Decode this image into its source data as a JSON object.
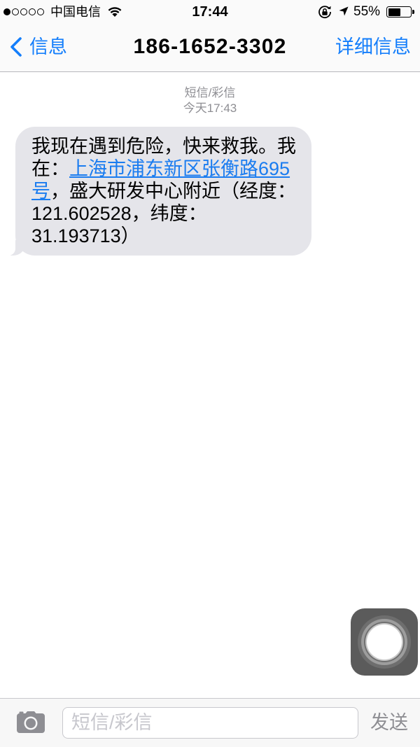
{
  "status": {
    "signal_strength": 1,
    "signal_max": 5,
    "carrier": "中国电信",
    "time": "17:44",
    "battery_text": "55%",
    "battery_level": 55
  },
  "nav": {
    "back_label": "信息",
    "title": "186-1652-3302",
    "details_label": "详细信息"
  },
  "thread": {
    "service_label": "短信/彩信",
    "timestamp": "今天17:43",
    "messages": [
      {
        "text_before": "我现在遇到危险，快来救我。我在：",
        "link_text": "上海市浦东新区张衡路695号",
        "text_after": "，盛大研发中心附近（经度：121.602528，纬度：31.193713）"
      }
    ]
  },
  "composer": {
    "placeholder": "短信/彩信",
    "send_label": "发送",
    "send_enabled": false
  },
  "icons": {
    "signal": "signal-strength-icon",
    "wifi": "wifi-icon",
    "orientation_lock": "orientation-lock-icon",
    "location": "location-arrow-icon",
    "battery": "battery-icon",
    "back": "chevron-left-icon",
    "camera": "camera-icon",
    "assistive_touch": "assistive-touch-icon"
  },
  "colors": {
    "accent": "#147EFB",
    "link": "#1A7CF0",
    "incoming_bubble": "#E5E5EA",
    "secondary_text": "#8E8E93"
  }
}
